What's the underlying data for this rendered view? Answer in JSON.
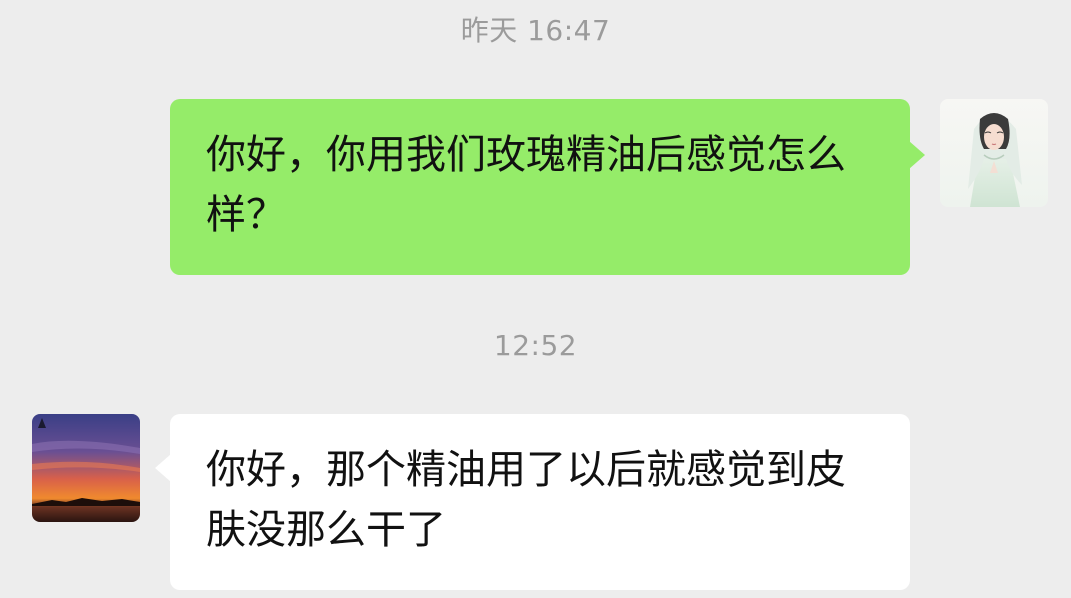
{
  "messages": [
    {
      "timestamp": "昨天 16:47",
      "sender": "self",
      "avatar": "woman-praying-avatar-icon",
      "text": "你好，你用我们玫瑰精油后感觉怎么样？",
      "bubble_color": "#95ec69"
    },
    {
      "timestamp": "12:52",
      "sender": "other",
      "avatar": "sunset-avatar-icon",
      "text": "你好，那个精油用了以后就感觉到皮肤没那么干了",
      "bubble_color": "#ffffff"
    }
  ],
  "colors": {
    "background": "#ededed",
    "timestamp": "#9b9b9b",
    "sent_bubble": "#95ec69",
    "received_bubble": "#ffffff"
  }
}
